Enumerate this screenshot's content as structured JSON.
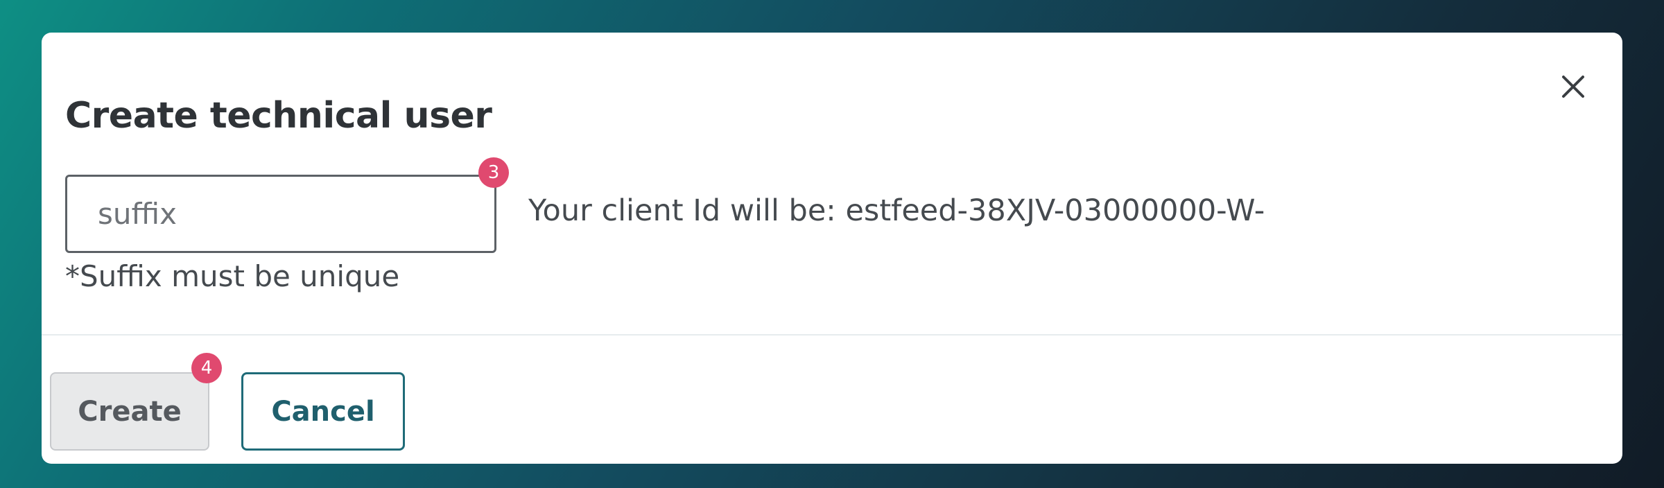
{
  "dialog": {
    "title": "Create technical user",
    "close_icon": "close-icon",
    "suffix_input": {
      "value": "",
      "placeholder": "suffix"
    },
    "client_id_text": "Your client Id will be: estfeed-38XJV-03000000-W-",
    "hint": "*Suffix must be unique",
    "buttons": {
      "create_label": "Create",
      "cancel_label": "Cancel"
    }
  },
  "badges": {
    "input_step": "3",
    "create_step": "4"
  },
  "colors": {
    "badge": "#e0496f",
    "cancel_accent": "#1f6b78",
    "create_disabled_bg": "#e8e9ea"
  }
}
